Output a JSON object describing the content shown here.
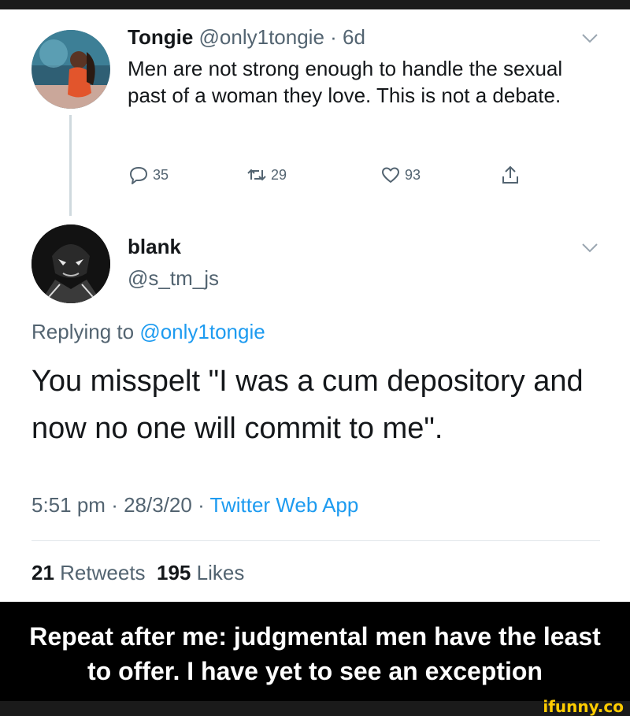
{
  "tweet1": {
    "name": "Tongie",
    "handle": "@only1tongie",
    "separator": "·",
    "age": "6d",
    "text": "Men are not strong enough to handle the sexual past of a woman they love. This is not a debate.",
    "actions": {
      "replies": "35",
      "retweets": "29",
      "likes": "93"
    }
  },
  "tweet2": {
    "name": "blank",
    "handle": "@s_tm_js",
    "replying_label": "Replying to",
    "replying_mention": "@only1tongie",
    "text": "You misspelt \"I was a cum depository and now no one will commit to me\".",
    "time": "5:51 pm",
    "date": "28/3/20",
    "separator": "·",
    "source": "Twitter Web App",
    "retweets_count": "21",
    "retweets_label": "Retweets",
    "likes_count": "195",
    "likes_label": "Likes"
  },
  "caption": "Repeat after me: judgmental men have the least to offer. I have yet to see an exception",
  "watermark": "ifunny.co",
  "icons": [
    "chevron-down-icon",
    "reply-icon",
    "retweet-icon",
    "like-icon",
    "share-icon"
  ],
  "colors": {
    "link_blue": "#1d9bf0",
    "muted_gray": "#536471",
    "caption_bg": "#000000",
    "watermark_yellow": "#ffcc00"
  }
}
